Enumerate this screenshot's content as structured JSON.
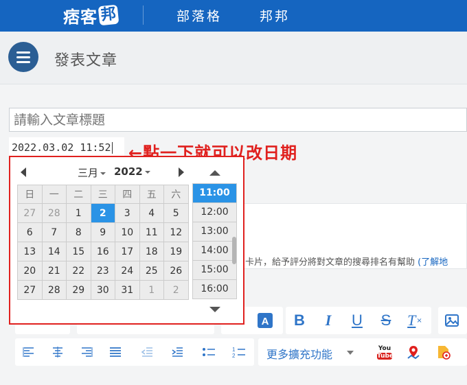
{
  "topbar": {
    "logo_text": "痞客",
    "logo_badge": "邦",
    "nav": [
      "部落格",
      "邦邦"
    ]
  },
  "header": {
    "title": "發表文章"
  },
  "editor": {
    "title_placeholder": "請輸入文章標題",
    "date_value": "2022.03.02 11:52",
    "annotation": "←點一下就可以改日期",
    "bg_text": "卡片，給予評分將對文章的搜尋排名有幫助",
    "bg_link": "(了解地"
  },
  "picker": {
    "month": "三月",
    "year": "2022",
    "weekdays": [
      "日",
      "一",
      "二",
      "三",
      "四",
      "五",
      "六"
    ],
    "weeks": [
      [
        "27",
        "28",
        "1",
        "2",
        "3",
        "4",
        "5"
      ],
      [
        "6",
        "7",
        "8",
        "9",
        "10",
        "11",
        "12"
      ],
      [
        "13",
        "14",
        "15",
        "16",
        "17",
        "18",
        "19"
      ],
      [
        "20",
        "21",
        "22",
        "23",
        "24",
        "25",
        "26"
      ],
      [
        "27",
        "28",
        "29",
        "30",
        "31",
        "1",
        "2"
      ]
    ],
    "selected_day": "2",
    "times": [
      "11:00",
      "12:00",
      "13:00",
      "14:00",
      "15:00",
      "16:00"
    ],
    "selected_time": "11:00"
  },
  "toolbar": {
    "row1": [
      "font-color-icon",
      "bold",
      "italic",
      "underline",
      "strikethrough",
      "clear-format",
      "image"
    ],
    "more_label": "更多擴充功能",
    "youtube_top": "You",
    "youtube_bottom": "Tube",
    "accent": "#2f75c8"
  }
}
